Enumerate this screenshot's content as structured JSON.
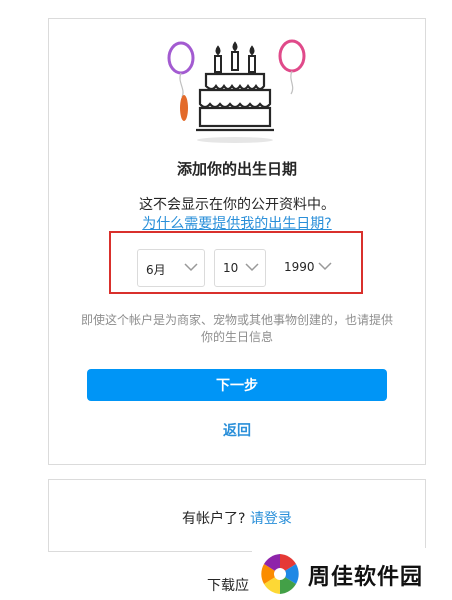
{
  "dialog": {
    "title": "添加你的出生日期",
    "subtitle": "这不会显示在你的公开资料中。",
    "why_link": "为什么需要提供我的出生日期?",
    "month": {
      "value": "6月"
    },
    "day": {
      "value": "10"
    },
    "year": {
      "value": "1990"
    },
    "note": "即使这个帐户是为商家、宠物或其他事物创建的，也请提供你的生日信息",
    "next_label": "下一步",
    "back_label": "返回"
  },
  "login": {
    "prompt": "有帐户了?",
    "link": "请登录"
  },
  "footer": {
    "download_text": "下载应"
  },
  "watermark": {
    "text": "周佳软件园"
  },
  "colors": {
    "primary_button": "#0095f6",
    "link": "#2a8fd9",
    "highlight": "#d9302c"
  }
}
